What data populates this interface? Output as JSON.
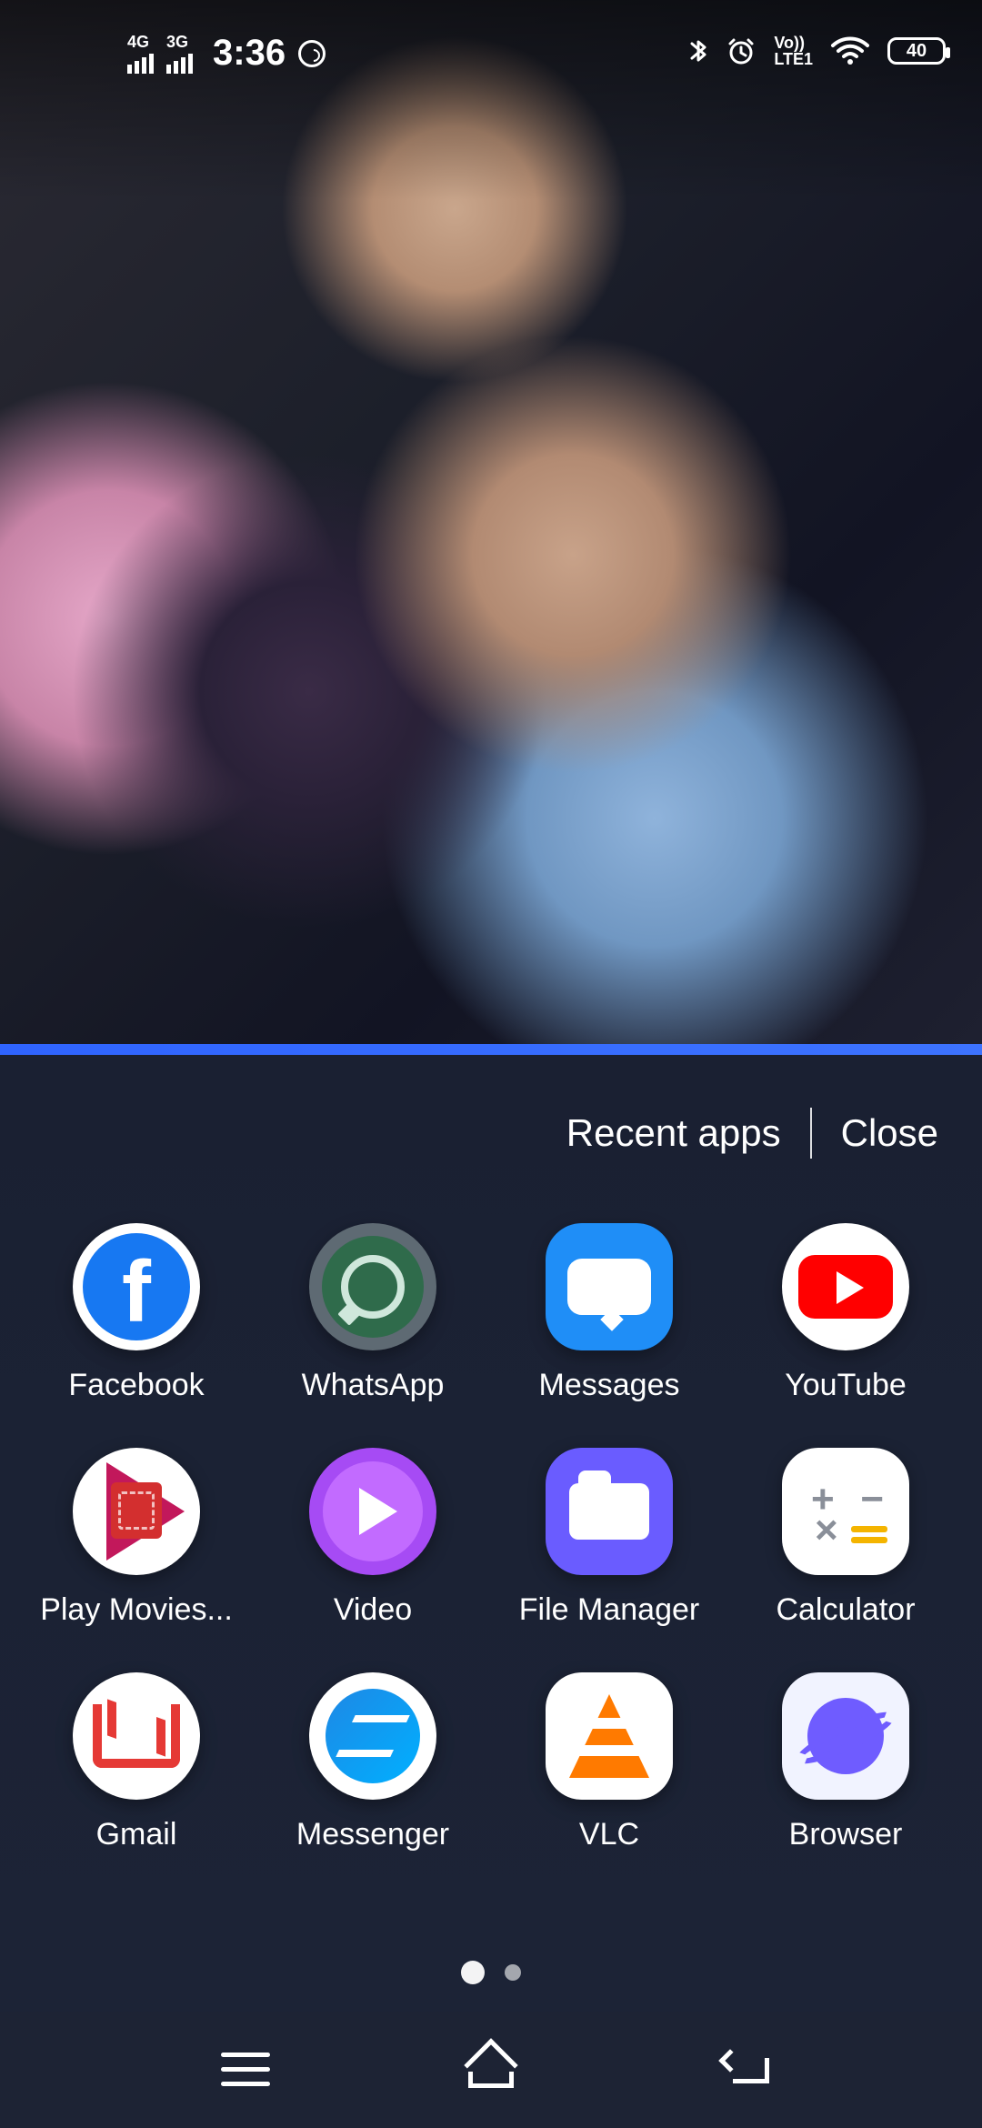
{
  "status_bar": {
    "network_1": "4G",
    "network_2": "3G",
    "time": "3:36",
    "volte_line1": "Vo))",
    "volte_line2": "LTE1",
    "battery_level": "40"
  },
  "recent_apps": {
    "title": "Recent apps",
    "close_label": "Close",
    "apps": [
      {
        "label": "Facebook"
      },
      {
        "label": "WhatsApp"
      },
      {
        "label": "Messages"
      },
      {
        "label": "YouTube"
      },
      {
        "label": "Play Movies..."
      },
      {
        "label": "Video"
      },
      {
        "label": "File Manager"
      },
      {
        "label": "Calculator"
      },
      {
        "label": "Gmail"
      },
      {
        "label": "Messenger"
      },
      {
        "label": "VLC"
      },
      {
        "label": "Browser"
      }
    ]
  },
  "page_indicator": {
    "current_page": 1,
    "total_pages": 2
  },
  "colors": {
    "accent_divider": "#2f64ff",
    "panel_bg": "#1a2032",
    "nav_bg": "#1d2334"
  },
  "icons": {
    "bluetooth": "bluetooth-icon",
    "alarm": "alarm-icon",
    "wifi": "wifi-icon",
    "battery": "battery-icon",
    "whatsapp_status": "whatsapp-icon",
    "menu": "menu-icon",
    "home": "home-icon",
    "back": "back-icon"
  }
}
